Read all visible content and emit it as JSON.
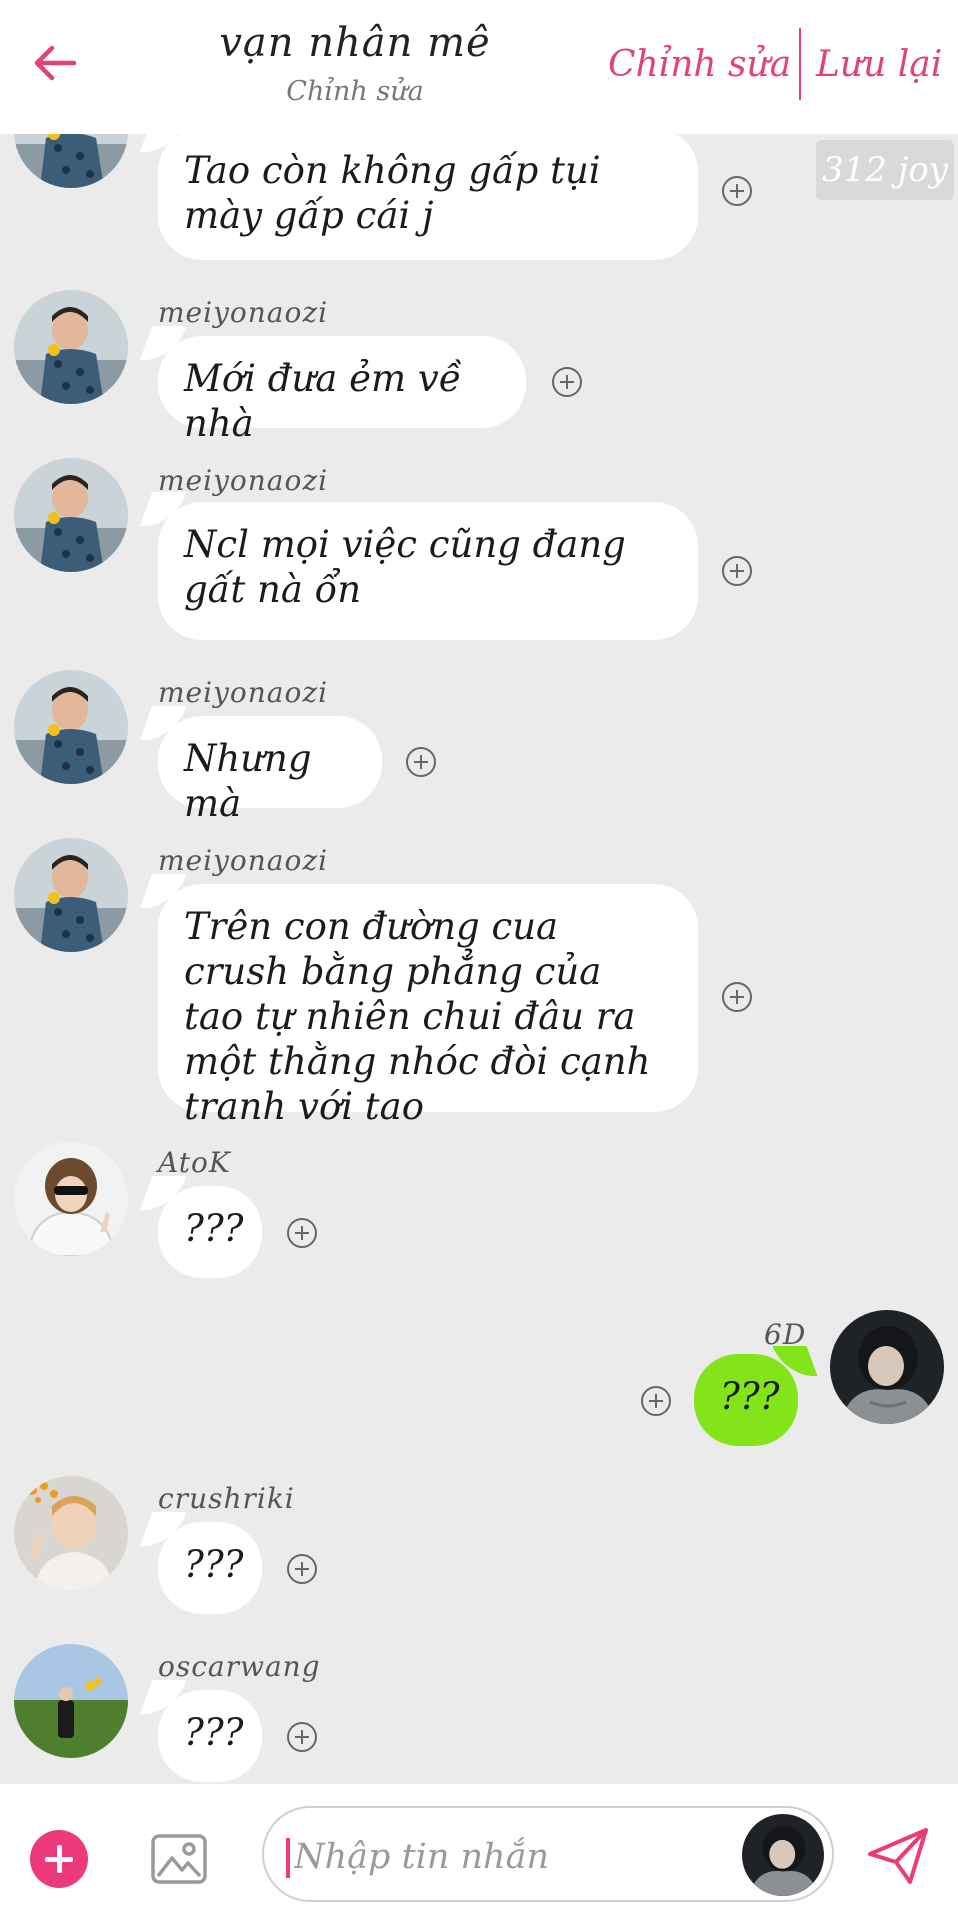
{
  "header": {
    "title": "vạn nhân mê",
    "subtitle": "Chỉnh sửa",
    "edit_label": "Chỉnh sửa",
    "save_label": "Lưu lại",
    "accent_color": "#e2417d"
  },
  "watermark": "312 joy",
  "messages": [
    {
      "sender": "",
      "text": "Tao còn không gấp tụi mày gấp cái j",
      "direction": "received",
      "avatar": "boy-flower"
    },
    {
      "sender": "meiyonaozi",
      "text": "Mới đưa ẻm về nhà",
      "direction": "received",
      "avatar": "boy-flower"
    },
    {
      "sender": "meiyonaozi",
      "text": "Ncl mọi việc cũng đang gất nà ổn",
      "direction": "received",
      "avatar": "boy-flower"
    },
    {
      "sender": "meiyonaozi",
      "text": "Nhưng mà",
      "direction": "received",
      "avatar": "boy-flower"
    },
    {
      "sender": "meiyonaozi",
      "text": "Trên con đường cua crush bằng phẳng của tao tự nhiên chui đâu ra một thằng nhóc đòi cạnh tranh với tao",
      "direction": "received",
      "avatar": "boy-flower"
    },
    {
      "sender": "AtoK",
      "text": "???",
      "direction": "received",
      "avatar": "girl-sunglasses"
    },
    {
      "sender": "6D",
      "text": "???",
      "direction": "sent",
      "avatar": "hoodie"
    },
    {
      "sender": "crushriki",
      "text": "???",
      "direction": "received",
      "avatar": "riki"
    },
    {
      "sender": "oscarwang",
      "text": "???",
      "direction": "received",
      "avatar": "field"
    }
  ],
  "input": {
    "placeholder": "Nhập tin nhắn",
    "value": ""
  },
  "colors": {
    "background": "#ebebeb",
    "bubble_received": "#ffffff",
    "bubble_sent": "#84e41a",
    "add_button": "#ec3a7a"
  }
}
